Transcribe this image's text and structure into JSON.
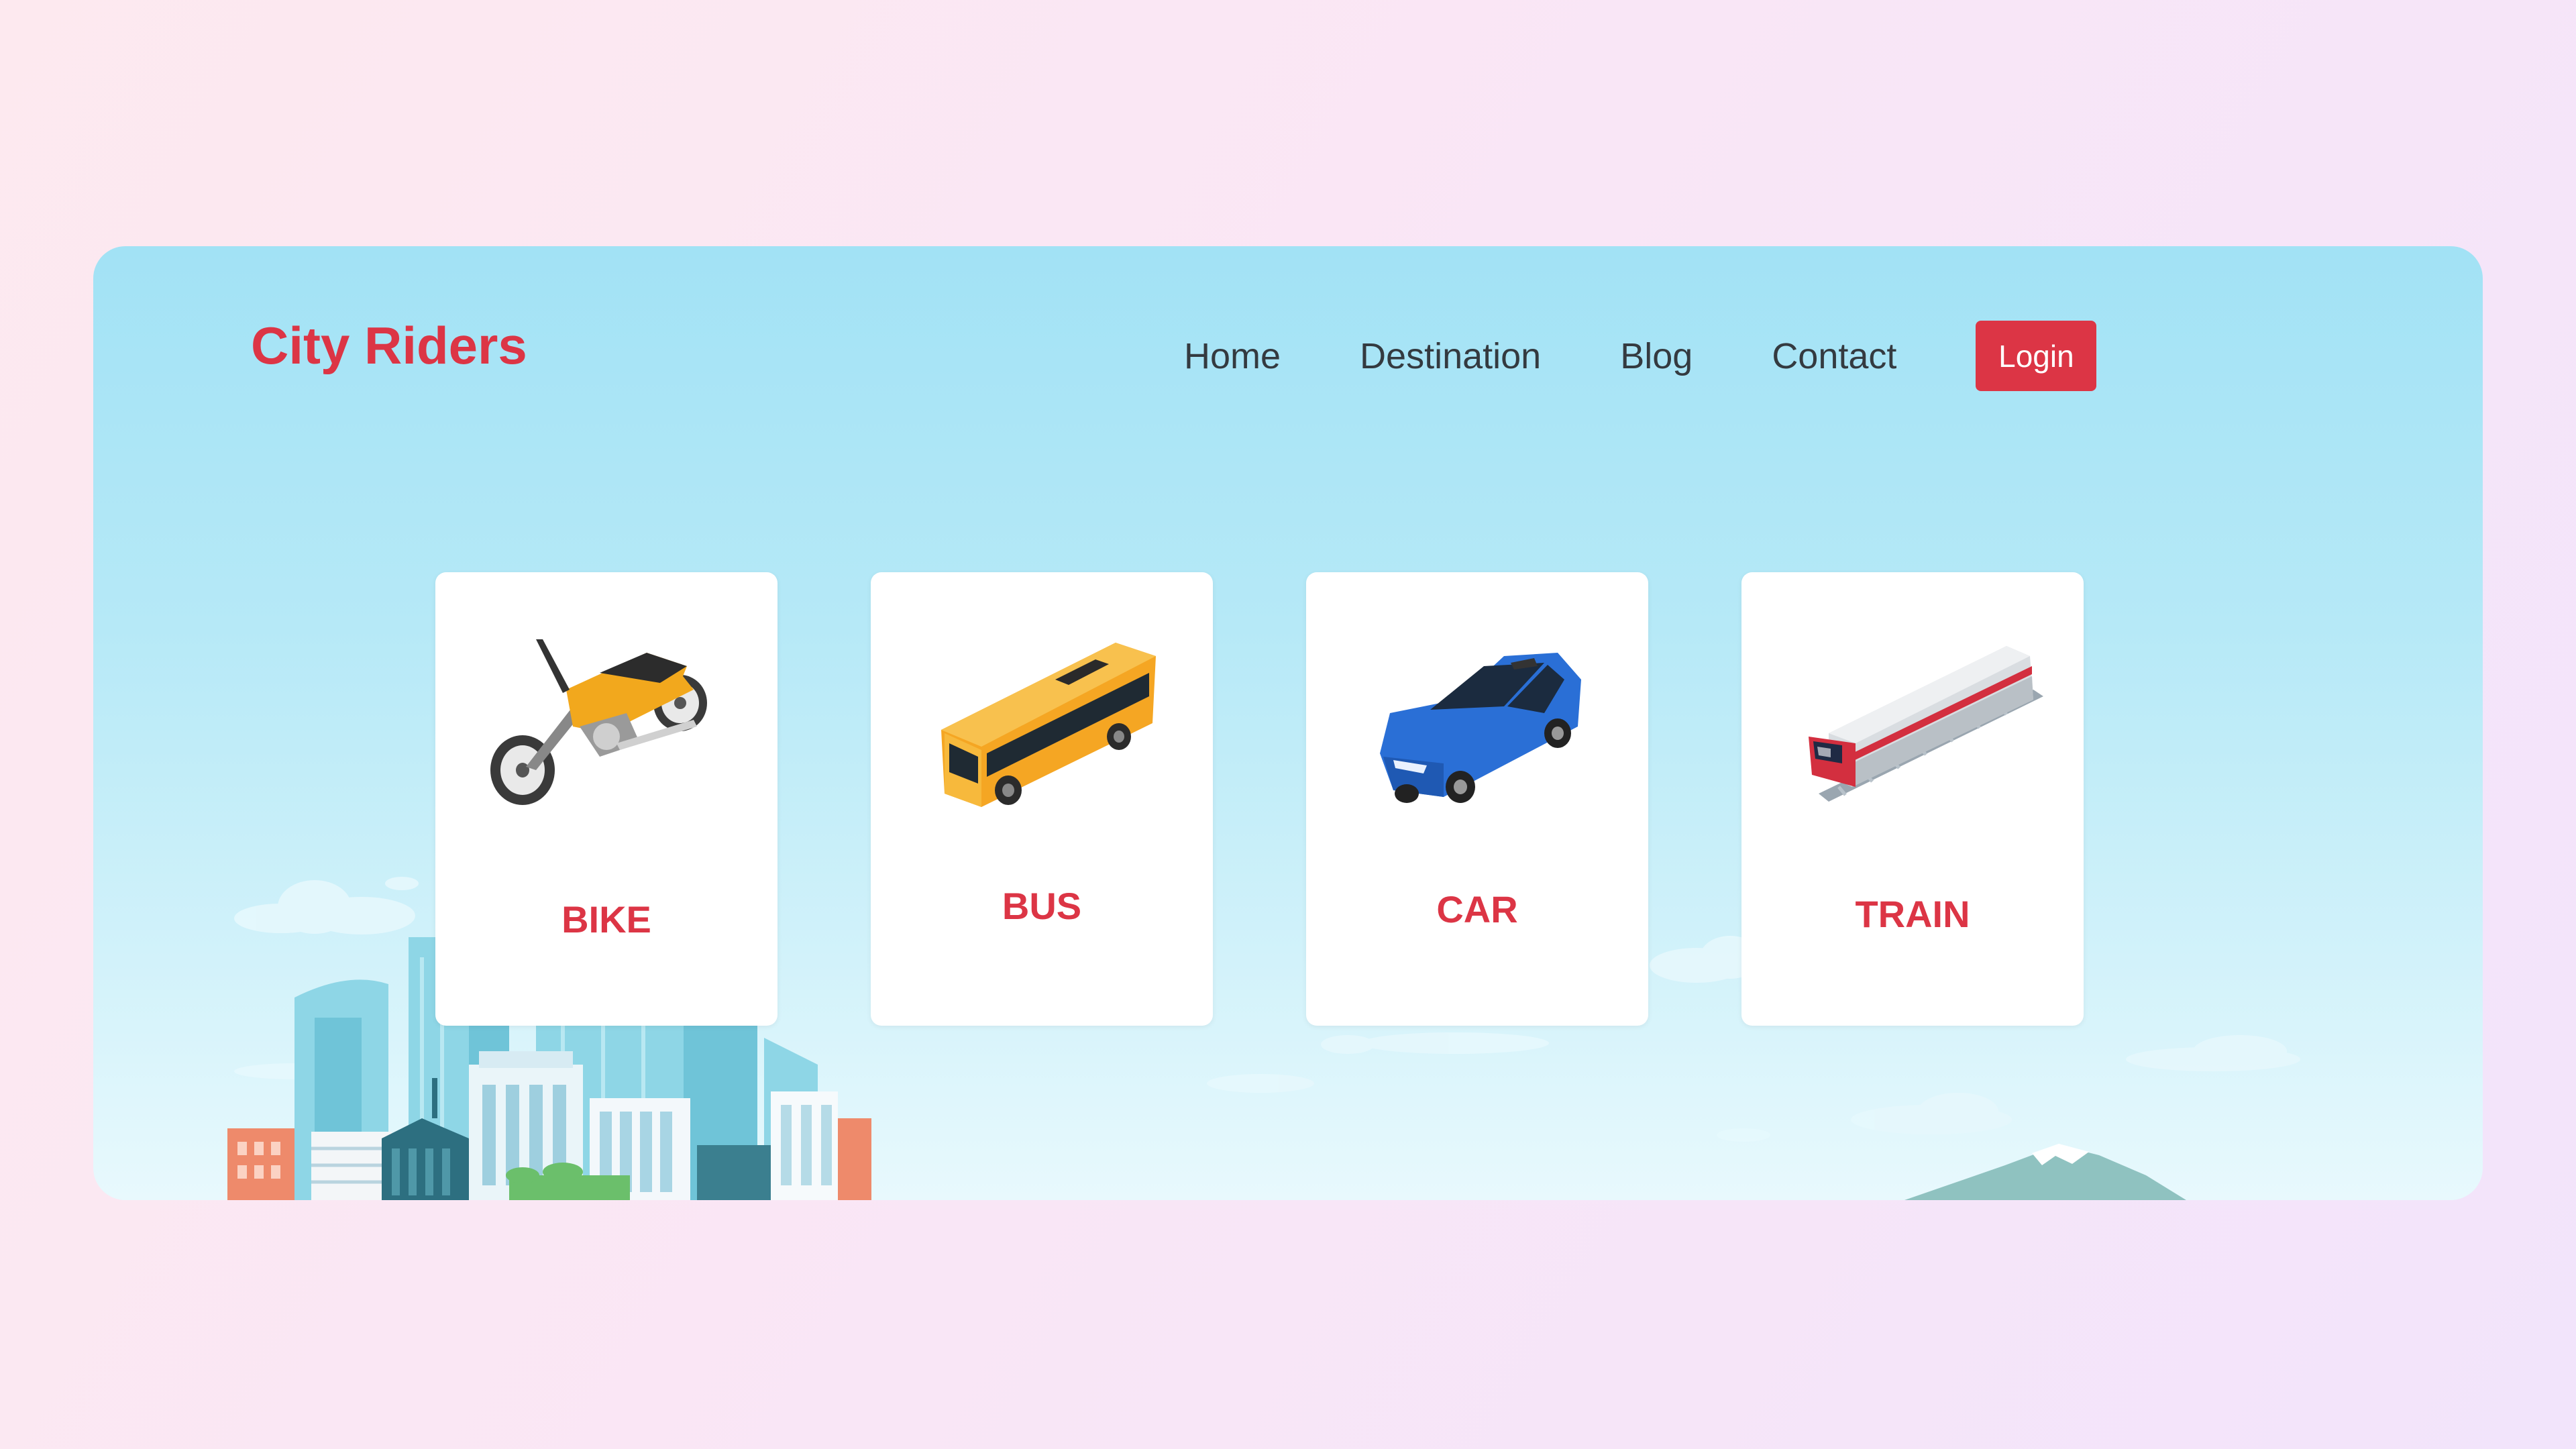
{
  "header": {
    "brand": "City Riders",
    "nav": [
      "Home",
      "Destination",
      "Blog",
      "Contact"
    ],
    "login_label": "Login"
  },
  "vehicles": [
    {
      "label": "BIKE",
      "icon": "motorcycle-icon"
    },
    {
      "label": "BUS",
      "icon": "bus-icon"
    },
    {
      "label": "CAR",
      "icon": "car-icon"
    },
    {
      "label": "TRAIN",
      "icon": "train-icon"
    }
  ],
  "colors": {
    "accent": "#dc3545",
    "panel_top": "#a2e2f5",
    "panel_bottom": "#e8f9fd",
    "nav_text": "#343a40"
  }
}
